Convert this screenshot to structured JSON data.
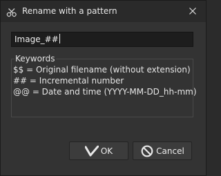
{
  "window": {
    "title": "Rename with a pattern",
    "icon": "scissors-icon",
    "close_icon": "close-icon"
  },
  "pattern": {
    "value": "Image_##"
  },
  "keywords": {
    "legend": "Keywords",
    "lines": [
      "$$ = Original filename (without extension)",
      "## = Incremental number",
      "@@ = Date and time (YYYY-MM-DD_hh-mm)"
    ]
  },
  "buttons": {
    "ok": {
      "label": "OK",
      "icon": "checkmark-icon"
    },
    "cancel": {
      "label": "Cancel",
      "icon": "no-entry-icon"
    }
  },
  "colors": {
    "window_bg": "#333333",
    "titlebar_bg": "#2a2a2a",
    "input_bg": "#1d1d1d",
    "text": "#e6e6e6"
  }
}
